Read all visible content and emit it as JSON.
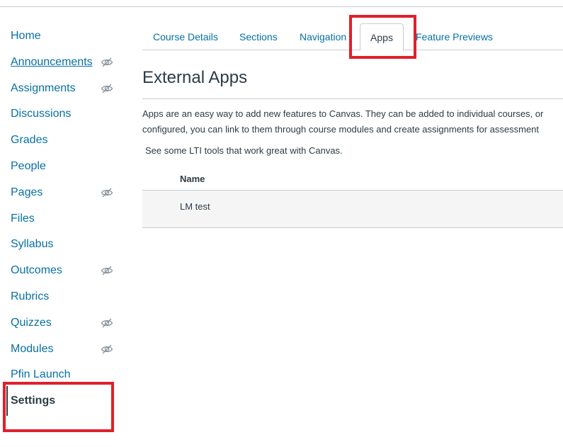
{
  "sidebar": {
    "items": [
      {
        "label": "Home",
        "hidden_icon": false
      },
      {
        "label": "Announcements",
        "hidden_icon": true
      },
      {
        "label": "Assignments",
        "hidden_icon": true
      },
      {
        "label": "Discussions",
        "hidden_icon": false
      },
      {
        "label": "Grades",
        "hidden_icon": false
      },
      {
        "label": "People",
        "hidden_icon": false
      },
      {
        "label": "Pages",
        "hidden_icon": true
      },
      {
        "label": "Files",
        "hidden_icon": false
      },
      {
        "label": "Syllabus",
        "hidden_icon": false
      },
      {
        "label": "Outcomes",
        "hidden_icon": true
      },
      {
        "label": "Rubrics",
        "hidden_icon": false
      },
      {
        "label": "Quizzes",
        "hidden_icon": true
      },
      {
        "label": "Modules",
        "hidden_icon": true
      },
      {
        "label": "Pfin Launch",
        "hidden_icon": false
      },
      {
        "label": "Settings",
        "hidden_icon": false
      }
    ],
    "eye_icon": "eye-slash-icon"
  },
  "tabs": [
    {
      "label": "Course Details"
    },
    {
      "label": "Sections"
    },
    {
      "label": "Navigation"
    },
    {
      "label": "Apps"
    },
    {
      "label": "Feature Previews"
    }
  ],
  "main": {
    "title": "External Apps",
    "description_line1": "Apps are an easy way to add new features to Canvas. They can be added to individual courses, or",
    "description_line2": "configured, you can link to them through course modules and create assignments for assessment",
    "lti_text": "See some LTI tools that work great with Canvas.",
    "table": {
      "header_name": "Name",
      "rows": [
        {
          "name": "LM test"
        }
      ]
    }
  },
  "colors": {
    "link": "#0770a3",
    "text": "#2d3b45",
    "highlight": "#e0202a"
  }
}
